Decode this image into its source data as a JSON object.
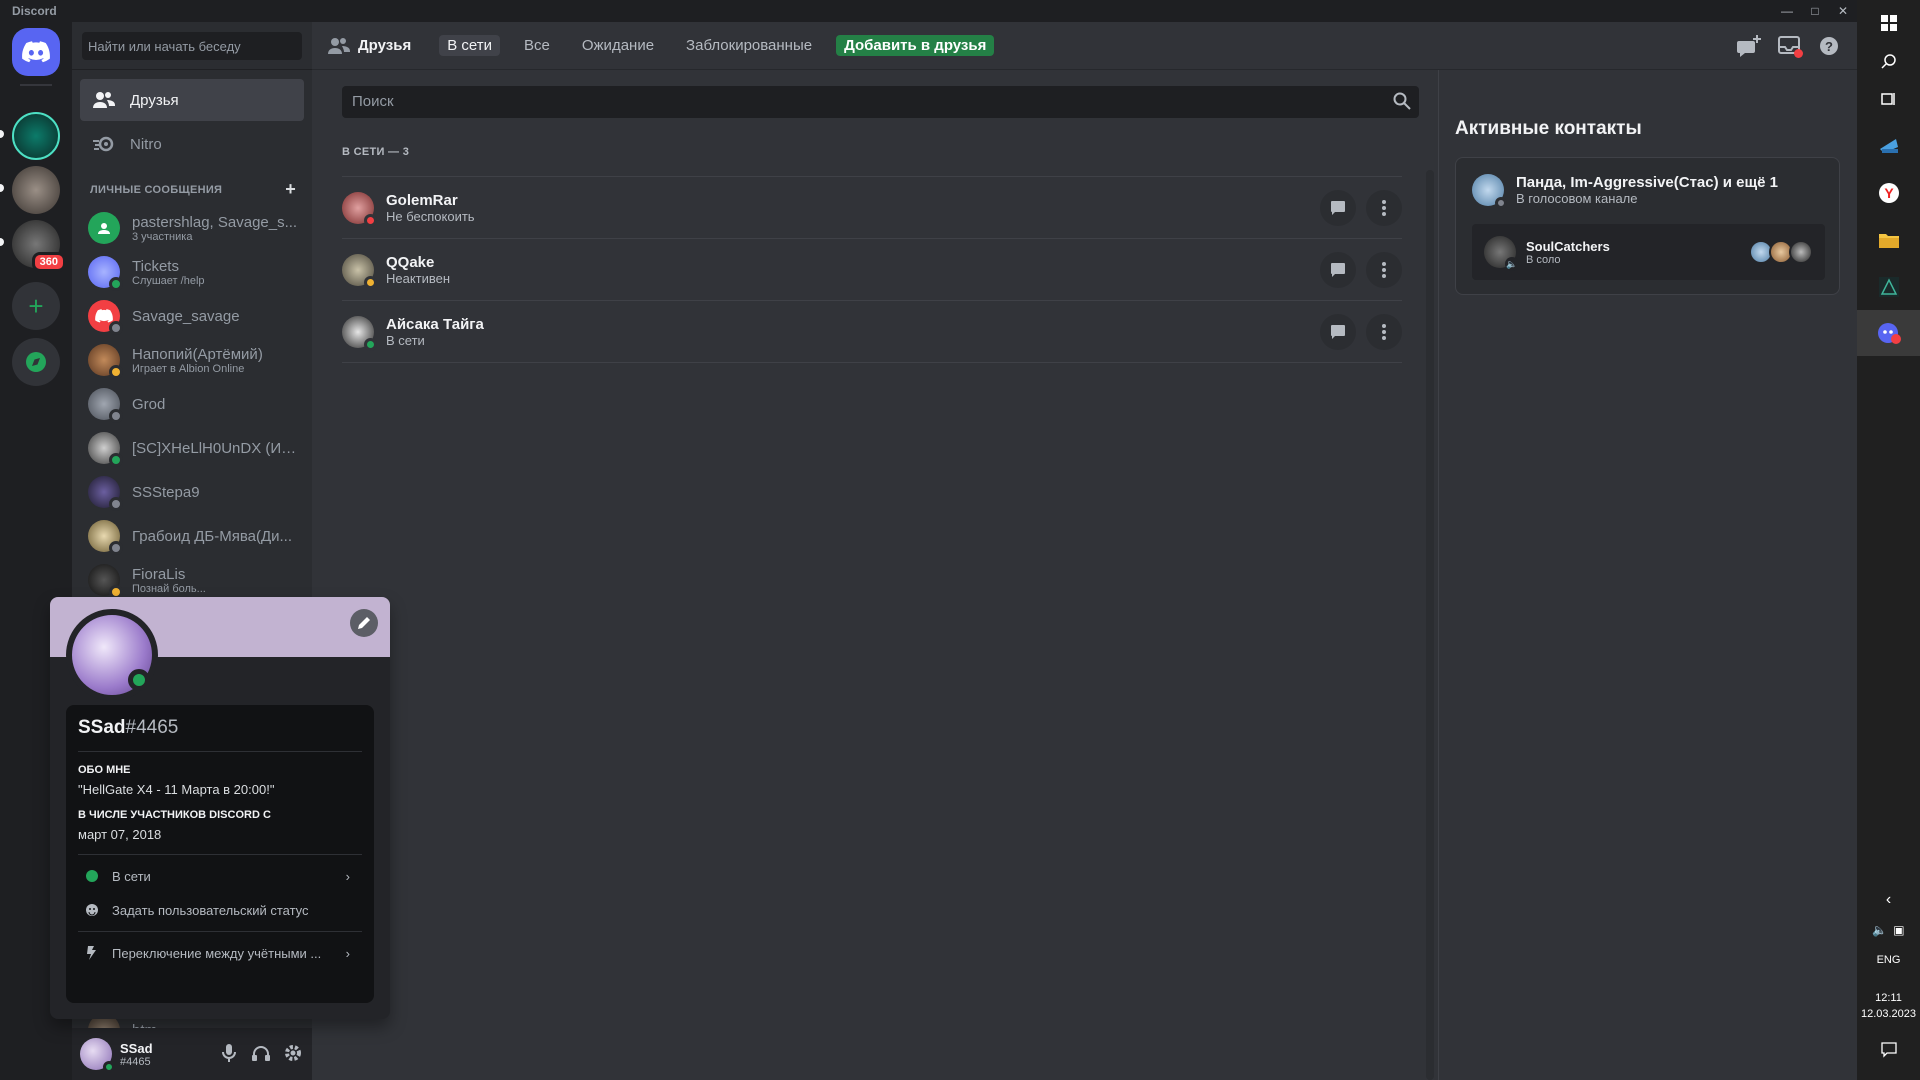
{
  "window": {
    "app_name": "Discord"
  },
  "dm_sidebar": {
    "search_placeholder": "Найти или начать беседу",
    "nav": [
      {
        "label": "Друзья"
      },
      {
        "label": "Nitro"
      }
    ],
    "dm_header": "ЛИЧНЫЕ СООБЩЕНИЯ",
    "dms": [
      {
        "name": "pastershlag, Savage_s...",
        "sub": "3 участника"
      },
      {
        "name": "Tickets",
        "sub": "Слушает /help"
      },
      {
        "name": "Savage_savage",
        "sub": ""
      },
      {
        "name": "Напопий(Артёмий)",
        "sub": "Играет в Albion Online"
      },
      {
        "name": "Grod",
        "sub": ""
      },
      {
        "name": "[SC]XHeLlH0UnDX (Ил...",
        "sub": ""
      },
      {
        "name": "SSStepa9",
        "sub": ""
      },
      {
        "name": "Грабоид ДБ-Мява(Ди...",
        "sub": ""
      },
      {
        "name": "FioraLis",
        "sub": "Познай боль..."
      },
      {
        "name": "btm",
        "sub": ""
      }
    ]
  },
  "rail": {
    "badge": "360"
  },
  "user_panel": {
    "name": "SSad",
    "tag": "#4465"
  },
  "topbar": {
    "title": "Друзья",
    "tabs": [
      {
        "label": "В сети"
      },
      {
        "label": "Все"
      },
      {
        "label": "Ожидание"
      },
      {
        "label": "Заблокированные"
      }
    ],
    "add_friend": "Добавить в друзья"
  },
  "friends": {
    "search_placeholder": "Поиск",
    "section": "В СЕТИ — 3",
    "list": [
      {
        "name": "GolemRar",
        "status": "Не беспокоить"
      },
      {
        "name": "QQake",
        "status": "Неактивен"
      },
      {
        "name": "Айсака Тайга",
        "status": "В сети"
      }
    ]
  },
  "active_now": {
    "title": "Активные контакты",
    "card": {
      "title": "Панда, Im-Aggressive(Стас) и ещё 1",
      "sub": "В голосовом канале",
      "voice_name": "SoulCatchers",
      "voice_sub": "В соло"
    }
  },
  "profile": {
    "username": "SSad",
    "discriminator": "#4465",
    "about_label": "ОБО МНЕ",
    "about_text": "\"HellGate X4 - 11 Марта в 20:00!\"",
    "member_label": "В ЧИСЛЕ УЧАСТНИКОВ DISCORD С",
    "member_since": "март 07, 2018",
    "status": "В сети",
    "custom_status": "Задать пользовательский статус",
    "switch_accounts": "Переключение между учётными ..."
  },
  "taskbar": {
    "lang": "ENG",
    "time": "12:11",
    "date": "12.03.2023"
  },
  "colors": {
    "online": "#23a55a",
    "dnd": "#f23f43",
    "idle": "#f0b232",
    "offline": "#80848e",
    "brand": "#5865f2",
    "add_green": "#248046"
  }
}
